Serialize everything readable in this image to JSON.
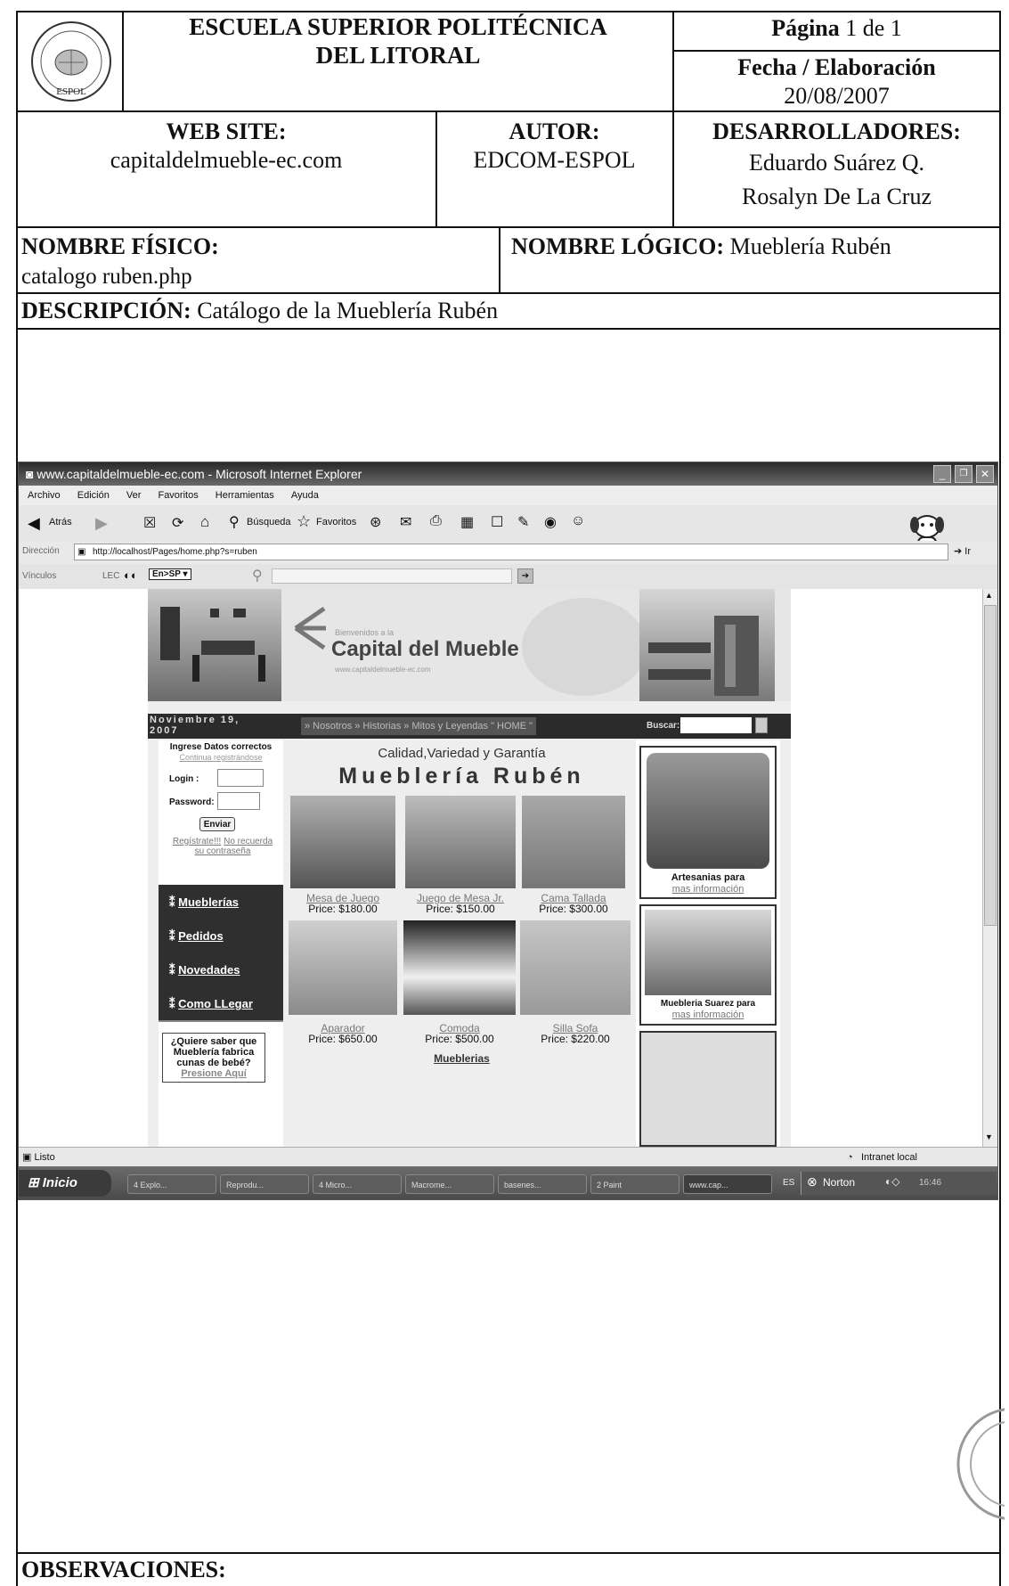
{
  "header": {
    "institution_line1": "ESCUELA SUPERIOR POLITÉCNICA",
    "institution_line2": "DEL LITORAL",
    "page_label": "Página",
    "page_value": "1 de 1",
    "date_label": "Fecha / Elaboración",
    "date_value": "20/08/2007",
    "website_label": "WEB SITE:",
    "website_value": "capitaldelmueble-ec.com",
    "author_label": "AUTOR:",
    "author_value": "EDCOM-ESPOL",
    "developers_label": "DESARROLLADORES:",
    "developer_1": "Eduardo Suárez Q.",
    "developer_2": "Rosalyn De La Cruz",
    "physical_name_label": "NOMBRE FÍSICO:",
    "physical_name_value": "catalogo ruben.php",
    "logical_name_label": "NOMBRE LÓGICO:",
    "logical_name_value": "Mueblería Rubén",
    "description_label": "DESCRIPCIÓN:",
    "description_value": "Catálogo de la Mueblería Rubén",
    "observations_label": "OBSERVACIONES:",
    "logo_text": "ESPOL"
  },
  "browser": {
    "window_title": "www.capitaldelmueble-ec.com - Microsoft Internet Explorer",
    "menu": [
      "Archivo",
      "Edición",
      "Ver",
      "Favoritos",
      "Herramientas",
      "Ayuda"
    ],
    "back_label": "Atrás",
    "search_label": "Búsqueda",
    "favorites_label": "Favoritos",
    "address_label": "Dirección",
    "address_value": "http://localhost/Pages/home.php?s=ruben",
    "go_label": "Ir",
    "links_label": "Vínculos",
    "lec_label": "LEC",
    "translate_label": "En>SP",
    "status_text": "Listo",
    "zone_text": "Intranet local",
    "taskbar": {
      "start_label": "Inicio",
      "items": [
        "4 Explo...",
        "Reprodu...",
        "4 Micro...",
        "Macrome...",
        "basenes...",
        "2 Paint",
        "www.cap..."
      ],
      "lang": "ES",
      "norton": "Norton",
      "clock": "16:46"
    }
  },
  "site": {
    "welcome": "Bienvenidos a la",
    "brand": "Capital del Mueble",
    "brand_url": "www.capitaldelmueble-ec.com",
    "date_left": "Noviembre 19,",
    "date_year": "2007",
    "nav": "» Nosotros » Historias » Mitos y Leyendas \" HOME \"",
    "search_label": "Buscar:",
    "login_title": "Ingrese Datos correctos",
    "login_subtitle": "Continua registrándose",
    "login_label": "Login :",
    "password_label": "Password:",
    "send_button": "Enviar",
    "register_link": "Regístrate!!!",
    "forgot_link": "No recuerda su contraseña",
    "menu": [
      "Mueblerías",
      "Pedidos",
      "Novedades",
      "Como LLegar"
    ],
    "promo_text": "¿Quiere saber que Mueblería fabrica cunas de bebé?",
    "promo_link": "Presione Aquí",
    "tagline": "Calidad,Variedad y Garantía",
    "store_title": "Mueblería Rubén",
    "products": [
      {
        "name": "Mesa de Juego",
        "price": "Price: $180.00"
      },
      {
        "name": "Juego de Mesa Jr.",
        "price": "Price: $150.00"
      },
      {
        "name": "Cama Tallada",
        "price": "Price: $300.00"
      },
      {
        "name": "Aparador",
        "price": "Price: $650.00"
      },
      {
        "name": "Comoda",
        "price": "Price: $500.00"
      },
      {
        "name": "Silla Sofa",
        "price": "Price: $220.00"
      }
    ],
    "bottom_link": "Mueblerias",
    "side_1_title": "Artesanias para",
    "side_1_link": "mas información",
    "side_2_title": "Muebleria Suarez para",
    "side_2_link": "mas información"
  },
  "colors": {
    "ink": "#111111",
    "dark_nav": "#2b2b2b",
    "title_bar": "#3a3a3a"
  }
}
